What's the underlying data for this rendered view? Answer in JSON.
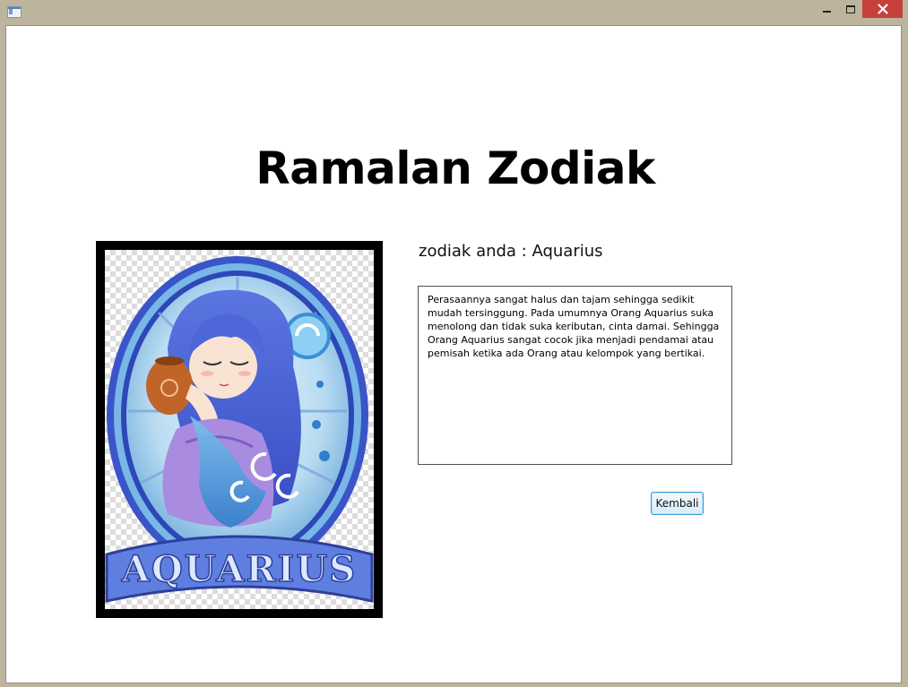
{
  "window": {
    "controls": {
      "minimize_icon": "minimize-icon",
      "maximize_icon": "maximize-icon",
      "close_icon": "close-icon"
    }
  },
  "page": {
    "title": "Ramalan Zodiak"
  },
  "zodiac": {
    "label": "zodiak anda : Aquarius",
    "image_lettering": "AQUARIUS",
    "description": "Perasaannya sangat halus dan tajam sehingga sedikit mudah tersinggung. Pada umumnya Orang Aquarius suka menolong dan tidak suka keributan, cinta damai. Sehingga Orang Aquarius sangat cocok jika menjadi pendamai atau pemisah ketika ada Orang atau kelompok yang bertikai."
  },
  "buttons": {
    "back_label": "Kembali"
  },
  "colors": {
    "titlebar": "#bcb49c",
    "close_button": "#c7403a",
    "button_border": "#3c9bd6",
    "frame": "#000000"
  }
}
